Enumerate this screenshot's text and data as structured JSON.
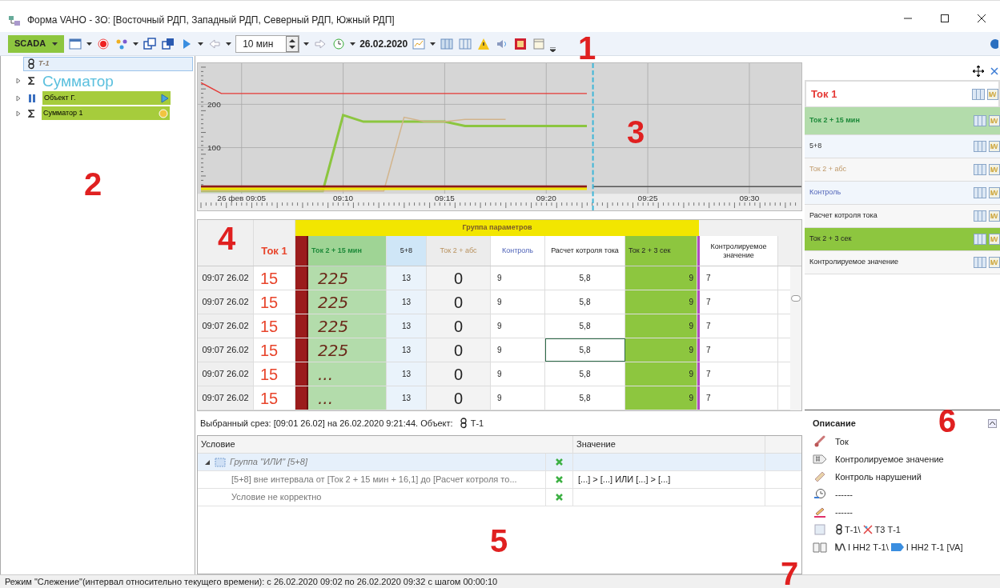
{
  "window": {
    "title": "Форма VAHO - 3О: [Восточный РДП, Западный РДП, Северный РДП, Южный РДП]"
  },
  "toolbar": {
    "scada": "SCADA",
    "interval": "10 мин",
    "date": "26.02.2020"
  },
  "tree": [
    {
      "label": "Т-1",
      "kind": "object",
      "selected": true
    },
    {
      "label": "Сумматор",
      "kind": "heading",
      "selected": false
    },
    {
      "label": "Объект Г.",
      "kind": "tagged",
      "selected": false
    },
    {
      "label": "Сумматор 1",
      "kind": "tagged-sum",
      "selected": false
    }
  ],
  "chart": {
    "chart_data": {
      "type": "line",
      "categories": [
        null,
        null,
        "26 фев 09:05",
        null,
        null,
        null,
        null,
        "09:10",
        null,
        null,
        null,
        null,
        "09:15",
        null,
        null,
        null,
        null,
        "09:20",
        null,
        null,
        null,
        null,
        "09:25",
        null,
        null,
        null,
        null,
        "09:30",
        null,
        null
      ],
      "series": [
        {
          "color": "#e53935",
          "values": [
            250,
            225,
            225,
            225,
            225,
            225,
            225,
            225,
            225,
            225,
            225,
            225,
            225,
            225,
            225,
            225,
            225,
            225,
            225,
            225,
            null,
            null,
            null,
            null,
            null,
            null,
            null,
            null,
            null,
            null
          ]
        },
        {
          "color": "#8cc63f",
          "values": [
            0,
            0,
            0,
            0,
            0,
            0,
            0,
            175,
            160,
            160,
            160,
            160,
            160,
            150,
            150,
            150,
            150,
            150,
            150,
            150,
            null,
            null,
            null,
            null,
            null,
            null,
            null,
            null,
            null,
            null
          ]
        },
        {
          "color": "#d2b48c",
          "values": [
            0,
            0,
            0,
            0,
            0,
            0,
            0,
            0,
            0,
            0,
            170,
            160,
            160,
            165,
            165,
            165,
            null,
            null,
            null,
            null,
            null,
            null,
            null,
            null,
            null,
            null,
            null,
            null,
            null,
            null
          ]
        },
        {
          "color": "#8b1a1a",
          "values": [
            10,
            10,
            10,
            10,
            10,
            10,
            10,
            10,
            10,
            10,
            10,
            10,
            10,
            10,
            10,
            10,
            10,
            10,
            10,
            10,
            null,
            null,
            null,
            null,
            null,
            null,
            null,
            null,
            null,
            null
          ]
        },
        {
          "color": "#f2e600",
          "values": [
            5,
            5,
            5,
            5,
            5,
            5,
            5,
            5,
            5,
            5,
            5,
            5,
            5,
            5,
            5,
            5,
            5,
            5,
            5,
            5,
            null,
            null,
            null,
            null,
            null,
            null,
            null,
            null,
            null,
            null
          ]
        }
      ],
      "ylim": [
        -45,
        295
      ],
      "yticks": [
        100,
        200
      ],
      "grid": true
    }
  },
  "table": {
    "group_header": "Группа параметров",
    "columns": [
      {
        "label": "Ток 1"
      },
      {
        "label": "Ток 2 + 15 мин"
      },
      {
        "label": "5+8"
      },
      {
        "label": "Ток 2 + абс"
      },
      {
        "label": "Контроль"
      },
      {
        "label": "Расчет котроля тока"
      },
      {
        "label": "Ток 2 + 3 сек"
      },
      {
        "label": "Контролируемое значение"
      }
    ],
    "rows": [
      {
        "time": "09:07 26.02",
        "cells": [
          {
            "text": "15",
            "selected": false
          },
          {
            "text": "225",
            "selected": false
          },
          {
            "text": "13",
            "selected": false
          },
          {
            "text": "0",
            "selected": false
          },
          {
            "text": "9",
            "selected": false
          },
          {
            "text": "5,8",
            "selected": false
          },
          {
            "text": "9",
            "selected": false
          },
          {
            "text": "7",
            "selected": false
          }
        ]
      },
      {
        "time": "09:07 26.02",
        "cells": [
          {
            "text": "15",
            "selected": false
          },
          {
            "text": "225",
            "selected": false
          },
          {
            "text": "13",
            "selected": false
          },
          {
            "text": "0",
            "selected": false
          },
          {
            "text": "9",
            "selected": false
          },
          {
            "text": "5,8",
            "selected": false
          },
          {
            "text": "9",
            "selected": false
          },
          {
            "text": "7",
            "selected": false
          }
        ]
      },
      {
        "time": "09:07 26.02",
        "cells": [
          {
            "text": "15",
            "selected": false
          },
          {
            "text": "225",
            "selected": false
          },
          {
            "text": "13",
            "selected": false
          },
          {
            "text": "0",
            "selected": false
          },
          {
            "text": "9",
            "selected": false
          },
          {
            "text": "5,8",
            "selected": false
          },
          {
            "text": "9",
            "selected": false
          },
          {
            "text": "7",
            "selected": false
          }
        ]
      },
      {
        "time": "09:07 26.02",
        "cells": [
          {
            "text": "15",
            "selected": false
          },
          {
            "text": "225",
            "selected": false
          },
          {
            "text": "13",
            "selected": false
          },
          {
            "text": "0",
            "selected": false
          },
          {
            "text": "9",
            "selected": false
          },
          {
            "text": "5,8",
            "selected": true
          },
          {
            "text": "9",
            "selected": false
          },
          {
            "text": "7",
            "selected": false
          }
        ]
      },
      {
        "time": "09:07 26.02",
        "cells": [
          {
            "text": "15",
            "selected": false
          },
          {
            "text": "...",
            "selected": false
          },
          {
            "text": "13",
            "selected": false
          },
          {
            "text": "0",
            "selected": false
          },
          {
            "text": "9",
            "selected": false
          },
          {
            "text": "5,8",
            "selected": false
          },
          {
            "text": "9",
            "selected": false
          },
          {
            "text": "7",
            "selected": false
          }
        ]
      },
      {
        "time": "09:07 26.02",
        "cells": [
          {
            "text": "15",
            "selected": false
          },
          {
            "text": "...",
            "selected": false
          },
          {
            "text": "13",
            "selected": false
          },
          {
            "text": "0",
            "selected": false
          },
          {
            "text": "9",
            "selected": false
          },
          {
            "text": "5,8",
            "selected": false
          },
          {
            "text": "9",
            "selected": false
          },
          {
            "text": "7",
            "selected": false
          }
        ]
      }
    ]
  },
  "slice": {
    "text": "Выбранный срез: [09:01 26.02] на 26.02.2020 9:21:44. Объект:",
    "object": "Т-1"
  },
  "conditions": {
    "columns": [
      "Условие",
      "Значение"
    ],
    "rows": [
      {
        "label": "Группа \"ИЛИ\" [5+8]",
        "selected": true,
        "expanded": true,
        "children": [
          {
            "label": "[5+8] вне интервала от [Ток 2 + 15 мин + 16,1] до [Расчет котроля то...",
            "value": "[...] > [...] ИЛИ [...] > [...]",
            "selected": false
          },
          {
            "label": "Условие не корректно",
            "selected": false
          }
        ]
      }
    ]
  },
  "parameters": [
    {
      "label": "Ток 1",
      "selected": true
    },
    {
      "label": "Ток 2 + 15 мин",
      "selected": false
    },
    {
      "label": "5+8",
      "selected": false
    },
    {
      "label": "Ток 2 + абс",
      "selected": false
    },
    {
      "label": "Контроль",
      "selected": false
    },
    {
      "label": "Расчет котроля тока",
      "selected": false
    },
    {
      "label": "Ток 2 + 3 сек",
      "selected": false
    },
    {
      "label": "Контролируемое значение",
      "selected": false
    }
  ],
  "description": {
    "title": "Описание",
    "items": [
      {
        "kind": "current",
        "parts": [
          "Ток"
        ]
      },
      {
        "kind": "controlled",
        "parts": [
          "Контролируемое значение"
        ]
      },
      {
        "kind": "violation",
        "parts": [
          "Контроль нарушений"
        ]
      },
      {
        "kind": "time",
        "parts": [
          "------"
        ]
      },
      {
        "kind": "edit",
        "parts": [
          "------"
        ]
      },
      {
        "kind": "object",
        "parts": [
          "Т-1\\",
          "Т3 Т-1"
        ]
      },
      {
        "kind": "reference",
        "parts": [
          "I НН2 Т-1\\",
          "I НН2 Т-1 [VA]"
        ]
      }
    ]
  },
  "status_bar": "Режим \"Слежение\"(интервал относительно текущего времени): с 26.02.2020 09:02 по 26.02.2020 09:32 с шагом 00:00:10",
  "callouts": [
    "1",
    "2",
    "3",
    "4",
    "5",
    "6",
    "7"
  ]
}
